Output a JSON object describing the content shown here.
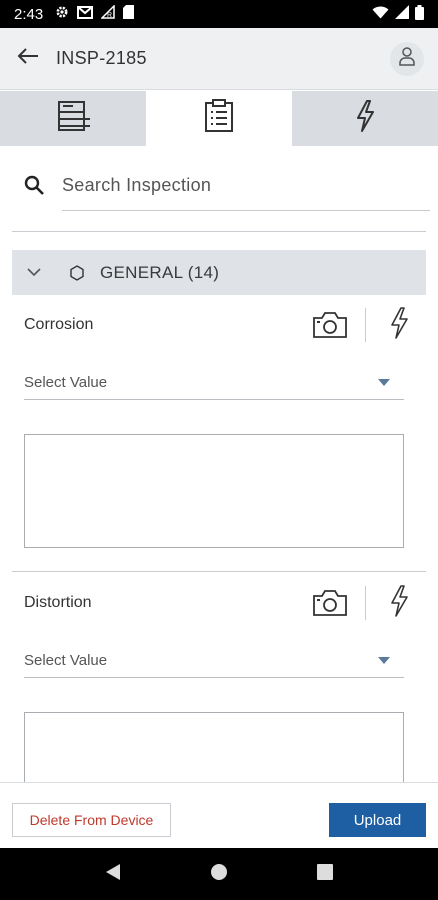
{
  "status_bar": {
    "time": "2:43",
    "left_icons": [
      "gear-icon",
      "mail-icon",
      "signal-r-icon",
      "sim-icon"
    ],
    "right_icons": [
      "wifi-icon",
      "cell-signal-icon",
      "battery-icon"
    ]
  },
  "app_bar": {
    "title": "INSP-2185"
  },
  "tabs": [
    {
      "icon": "form-icon",
      "active": false
    },
    {
      "icon": "clipboard-icon",
      "active": true
    },
    {
      "icon": "bolt-icon",
      "active": false
    }
  ],
  "search": {
    "placeholder": "Search Inspection"
  },
  "section": {
    "title": "GENERAL (14)",
    "expanded": true
  },
  "items": [
    {
      "label": "Corrosion",
      "select_placeholder": "Select Value",
      "notes": ""
    },
    {
      "label": "Distortion",
      "select_placeholder": "Select Value",
      "notes": ""
    }
  ],
  "footer": {
    "delete_label": "Delete From Device",
    "upload_label": "Upload"
  },
  "colors": {
    "accent": "#1e5fa3",
    "danger": "#c0392b",
    "appbar_bg": "#eef0f2",
    "tab_inactive_bg": "#d9dde1",
    "section_bg": "#dfe3e7"
  }
}
